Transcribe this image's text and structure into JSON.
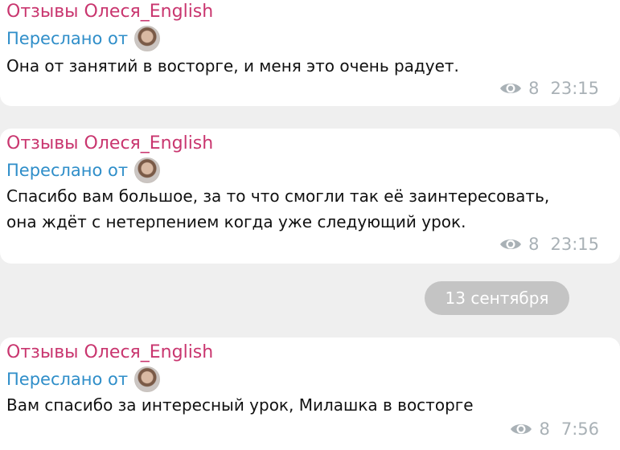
{
  "messages": [
    {
      "sender": "Отзывы Олеся_English",
      "forwarded_label": "Переслано от",
      "lines": [
        "Она от занятий в восторге,  и меня это очень радует."
      ],
      "views": "8",
      "time": "23:15"
    },
    {
      "sender": "Отзывы Олеся_English",
      "forwarded_label": "Переслано от",
      "lines": [
        "Спасибо вам большое,  за то что смогли так её заинтересовать,",
        "она ждёт с нетерпением когда уже следующий урок."
      ],
      "views": "8",
      "time": "23:15"
    },
    {
      "sender": "Отзывы Олеся_English",
      "forwarded_label": "Переслано от",
      "lines": [
        "Вам спасибо за интересный урок,  Милашка в восторге"
      ],
      "views": "8",
      "time": "7:56"
    }
  ],
  "date_separator": "13 сентября",
  "icons": {
    "views": "eye-icon",
    "avatar": "user-avatar"
  },
  "colors": {
    "sender": "#c9366f",
    "forwarded": "#2f8ec9",
    "meta": "#a9b1b6",
    "date_pill": "#c4c4c4",
    "background": "#efefef"
  }
}
